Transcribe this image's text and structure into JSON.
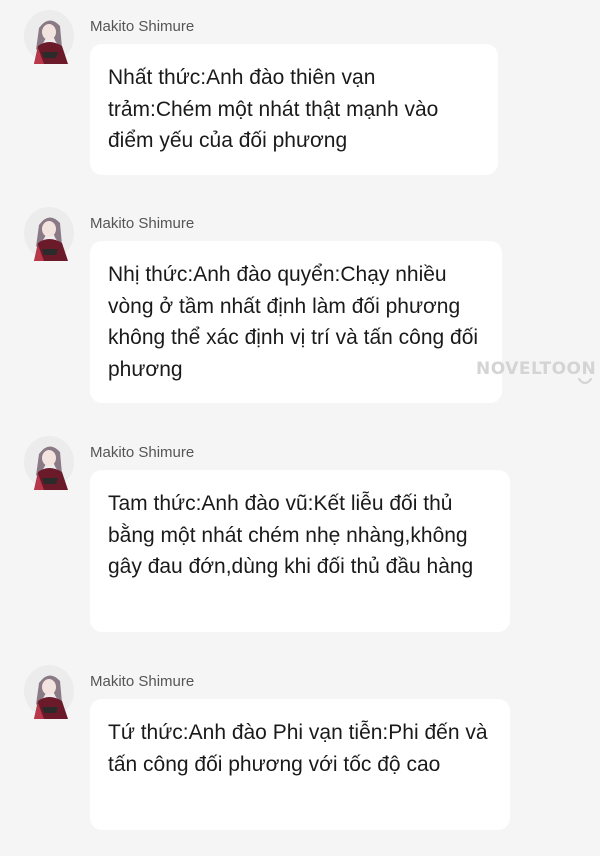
{
  "watermark": "NOVELTOON",
  "colors": {
    "background": "#f5f5f5",
    "bubble": "#ffffff",
    "avatar_accent": "#6b1a2a",
    "avatar_hair": "#8a7a86"
  },
  "messages": [
    {
      "sender": "Makito Shimure",
      "avatar_icon": "anime-character-avatar-icon",
      "text": "Nhất thức:Anh đào thiên vạn trảm:Chém một nhát thật mạnh vào điểm yếu của đối phương"
    },
    {
      "sender": "Makito Shimure",
      "avatar_icon": "anime-character-avatar-icon",
      "text": "Nhị thức:Anh đào quyển:Chạy nhiều vòng ở tầm nhất định làm đối phương không thể xác định vị trí và tấn công đối phương"
    },
    {
      "sender": "Makito Shimure",
      "avatar_icon": "anime-character-avatar-icon",
      "text": "Tam thức:Anh đào vũ:Kết liễu đối thủ bằng một nhát chém nhẹ nhàng,không gây đau đớn,dùng khi đối thủ đầu hàng"
    },
    {
      "sender": "Makito Shimure",
      "avatar_icon": "anime-character-avatar-icon",
      "text": "Tứ thức:Anh đào Phi vạn tiễn:Phi đến và tấn công đối phương với tốc độ cao"
    }
  ]
}
